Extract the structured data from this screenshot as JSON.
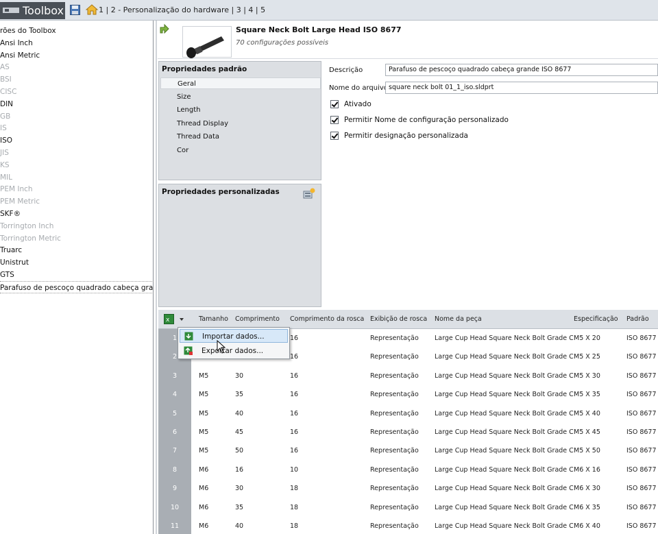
{
  "titlebar": {
    "app_label": "Toolbox",
    "steps": "1 | 2 - Personalização do hardware | 3 | 4 | 5"
  },
  "tree": {
    "items": [
      {
        "label": "rões do Toolbox",
        "dim": false
      },
      {
        "label": "Ansi Inch",
        "dim": false
      },
      {
        "label": "Ansi Metric",
        "dim": false
      },
      {
        "label": "AS",
        "dim": true
      },
      {
        "label": "BSI",
        "dim": true
      },
      {
        "label": "CISC",
        "dim": true
      },
      {
        "label": "DIN",
        "dim": false
      },
      {
        "label": "GB",
        "dim": true
      },
      {
        "label": "IS",
        "dim": true
      },
      {
        "label": "ISO",
        "dim": false
      },
      {
        "label": "JIS",
        "dim": true
      },
      {
        "label": "KS",
        "dim": true
      },
      {
        "label": "MIL",
        "dim": true
      },
      {
        "label": "PEM Inch",
        "dim": true
      },
      {
        "label": "PEM Metric",
        "dim": true
      },
      {
        "label": "SKF®",
        "dim": false
      },
      {
        "label": "Torrington Inch",
        "dim": true
      },
      {
        "label": "Torrington Metric",
        "dim": true
      },
      {
        "label": "Truarc",
        "dim": false
      },
      {
        "label": "Unistrut",
        "dim": false
      },
      {
        "label": "GTS",
        "dim": false
      },
      {
        "label": "Parafuso de pescoço quadrado cabeça grande ISO",
        "dim": false
      }
    ]
  },
  "header": {
    "title": "Square Neck Bolt Large Head ISO 8677",
    "subtitle": "70 configurações possíveis"
  },
  "standard_props": {
    "title": "Propriedades padrão",
    "items": [
      "Geral",
      "Size",
      "Length",
      "Thread Display",
      "Thread Data",
      "Cor"
    ]
  },
  "custom_props": {
    "title": "Propriedades personalizadas"
  },
  "form": {
    "desc_label": "Descrição",
    "desc_value": "Parafuso de pescoço quadrado cabeça grande ISO 8677",
    "file_label": "Nome do arquivo",
    "file_value": "square neck bolt 01_1_iso.sldprt",
    "checks": [
      "Ativado",
      "Permitir Nome de configuração personalizado",
      "Permitir designação personalizada"
    ]
  },
  "grid": {
    "columns": [
      "Tamanho",
      "Comprimento",
      "Comprimento da rosca",
      "Exibição de rosca",
      "Nome da peça",
      "Especificação",
      "Padrão"
    ],
    "rows": [
      [
        "1",
        "",
        "",
        "16",
        "Representação",
        "Large Cup Head Square Neck Bolt Grade C",
        "M5 X 20",
        "ISO 8677"
      ],
      [
        "2",
        "",
        "",
        "16",
        "Representação",
        "Large Cup Head Square Neck Bolt Grade C",
        "M5 X 25",
        "ISO 8677"
      ],
      [
        "3",
        "M5",
        "30",
        "16",
        "Representação",
        "Large Cup Head Square Neck Bolt Grade C",
        "M5 X 30",
        "ISO 8677"
      ],
      [
        "4",
        "M5",
        "35",
        "16",
        "Representação",
        "Large Cup Head Square Neck Bolt Grade C",
        "M5 X 35",
        "ISO 8677"
      ],
      [
        "5",
        "M5",
        "40",
        "16",
        "Representação",
        "Large Cup Head Square Neck Bolt Grade C",
        "M5 X 40",
        "ISO 8677"
      ],
      [
        "6",
        "M5",
        "45",
        "16",
        "Representação",
        "Large Cup Head Square Neck Bolt Grade C",
        "M5 X 45",
        "ISO 8677"
      ],
      [
        "7",
        "M5",
        "50",
        "16",
        "Representação",
        "Large Cup Head Square Neck Bolt Grade C",
        "M5 X 50",
        "ISO 8677"
      ],
      [
        "8",
        "M6",
        "16",
        "10",
        "Representação",
        "Large Cup Head Square Neck Bolt Grade C",
        "M6 X 16",
        "ISO 8677"
      ],
      [
        "9",
        "M6",
        "30",
        "18",
        "Representação",
        "Large Cup Head Square Neck Bolt Grade C",
        "M6 X 30",
        "ISO 8677"
      ],
      [
        "10",
        "M6",
        "35",
        "18",
        "Representação",
        "Large Cup Head Square Neck Bolt Grade C",
        "M6 X 35",
        "ISO 8677"
      ],
      [
        "11",
        "M6",
        "40",
        "18",
        "Representação",
        "Large Cup Head Square Neck Bolt Grade C",
        "M6 X 40",
        "ISO 8677"
      ]
    ]
  },
  "menu": {
    "import_label": "Importar dados...",
    "export_label": "Exportar dados..."
  }
}
